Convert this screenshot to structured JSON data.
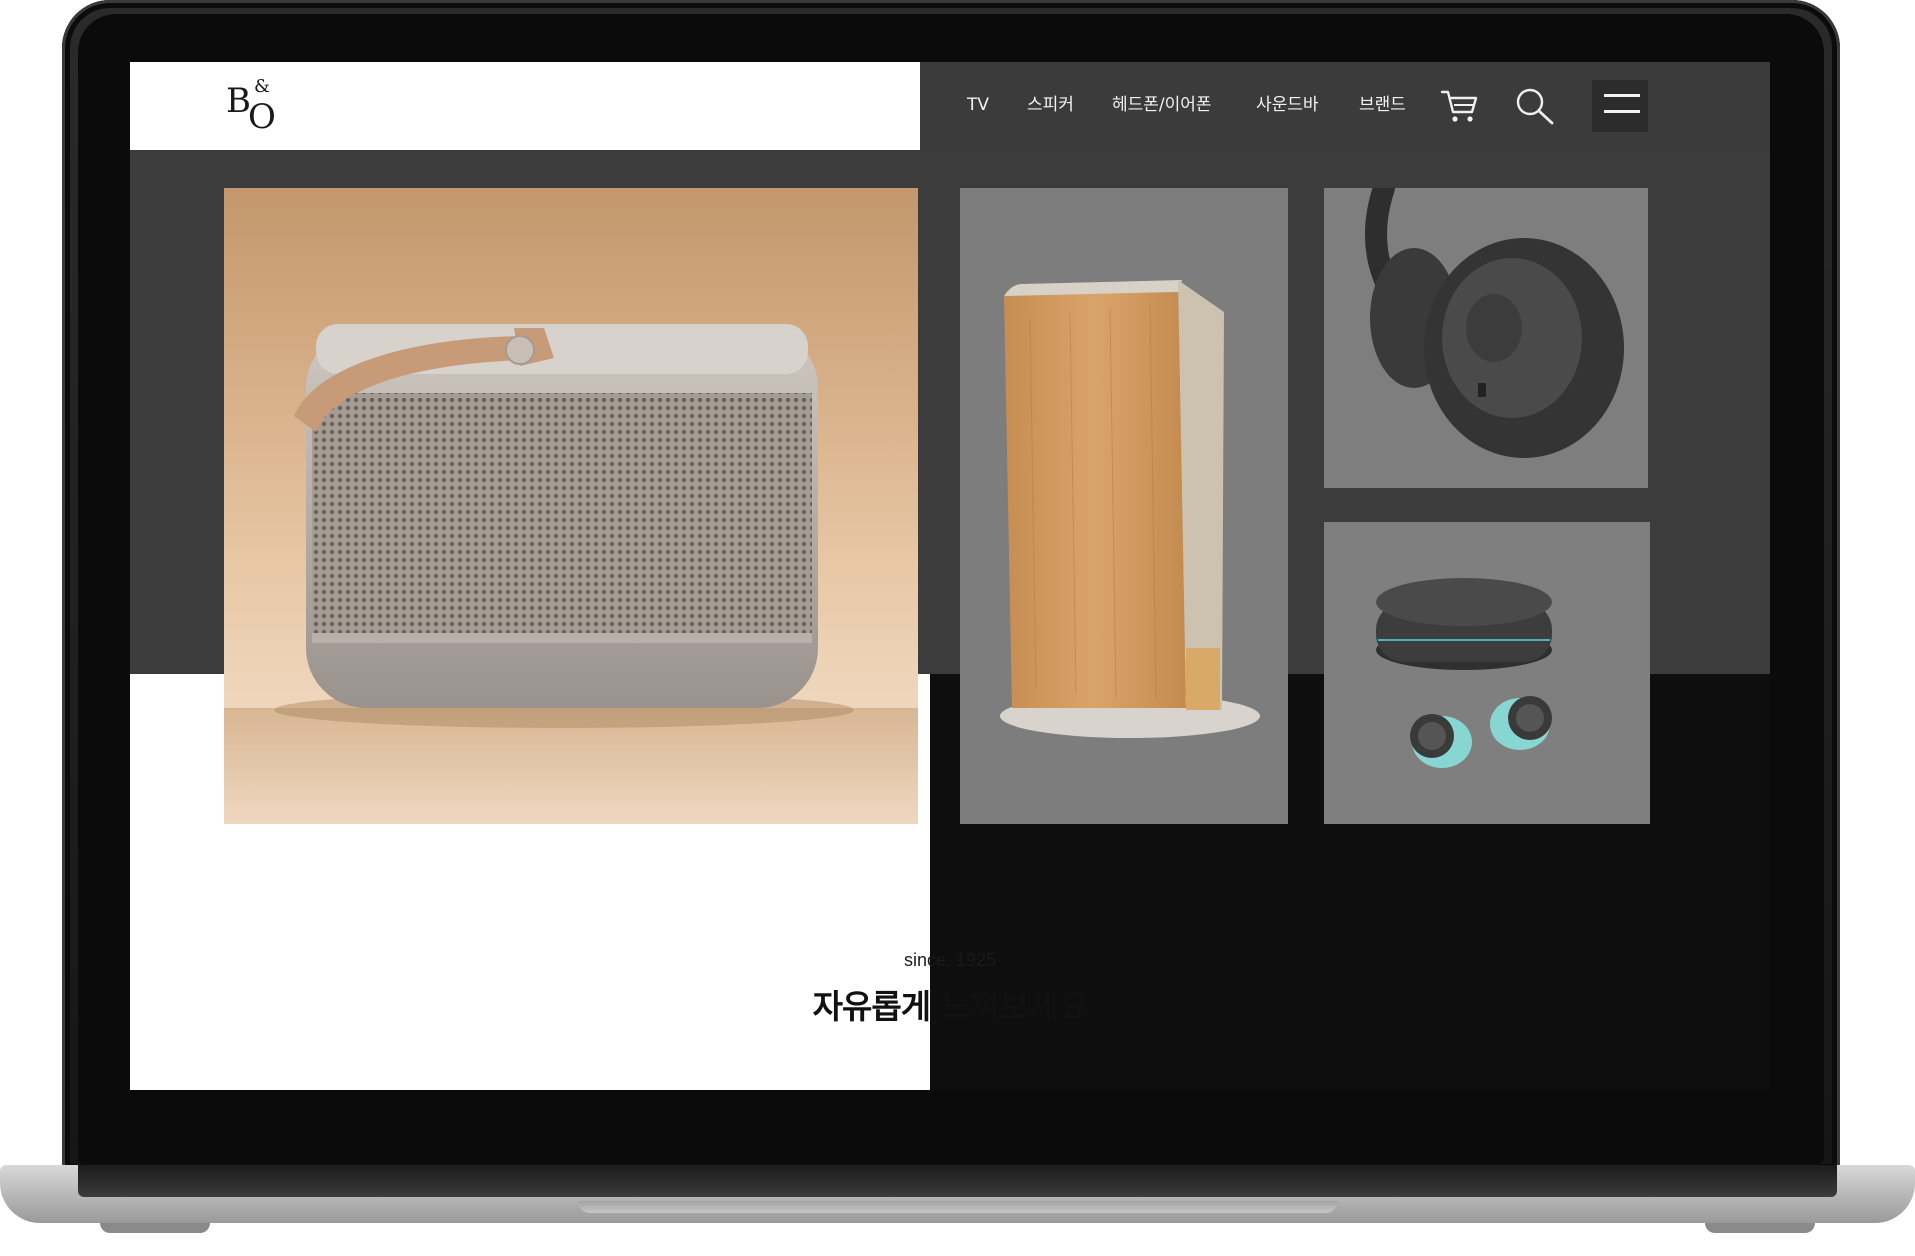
{
  "brand": {
    "logo_text": "B&O",
    "logo_alt": "Bang & Olufsen"
  },
  "nav": {
    "items": [
      {
        "label": "TV"
      },
      {
        "label": "스피커"
      },
      {
        "label": "헤드폰/이어폰"
      },
      {
        "label": "사운드바"
      },
      {
        "label": "브랜드"
      }
    ],
    "icons": [
      "cart-icon",
      "search-icon",
      "menu-icon"
    ]
  },
  "products": [
    {
      "name": "portable-speaker",
      "color": "#c9a07a"
    },
    {
      "name": "bookshelf-speaker",
      "color": "#c8955c"
    },
    {
      "name": "over-ear-headphones",
      "color": "#3a3a3a"
    },
    {
      "name": "wireless-earbuds",
      "color": "#3d3d3d"
    }
  ],
  "hero": {
    "since": "since. 1925",
    "headline": "자유롭게 느껴보세요"
  },
  "colors": {
    "header_dark": "#3b3b3b",
    "band_dark": "#3c3c3c",
    "screen_bg": "#0e0e0e",
    "tile_gray": "#7e7e7e",
    "accent_tan": "#c9a07a"
  }
}
